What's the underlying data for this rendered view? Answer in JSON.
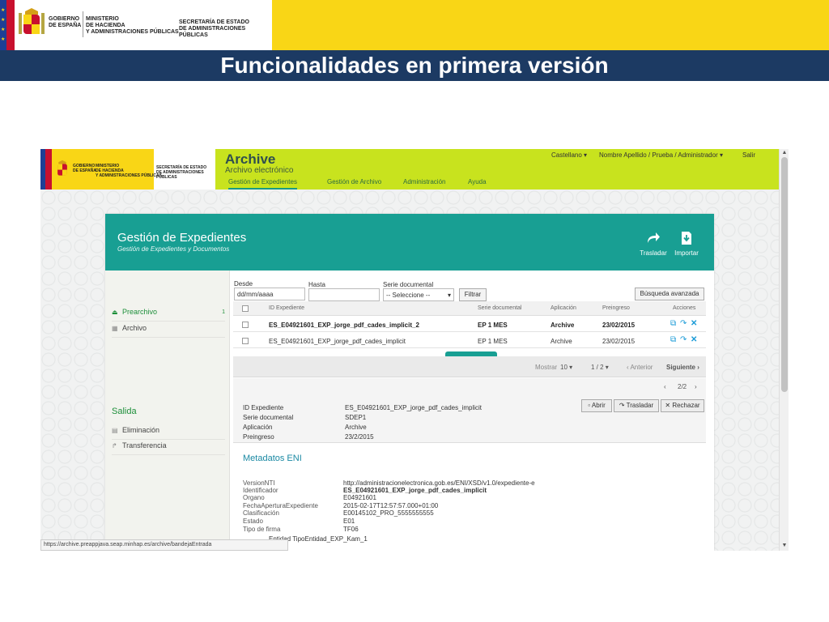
{
  "slide": {
    "gov_line1": "Gobierno",
    "gov_line2": "de España",
    "ministry_line1": "Ministerio",
    "ministry_line2": "de Hacienda",
    "ministry_line3": "y Administraciones Públicas",
    "secretariat_line1": "Secretaría de Estado",
    "secretariat_line2": "de Administraciones Públicas",
    "title": "Funcionalidades en primera versión"
  },
  "app": {
    "title": "Archive",
    "subtitle": "Archivo electrónico",
    "language": "Castellano ▾",
    "user": "Nombre Apellido / Prueba / Administrador ▾",
    "logout": "Salir",
    "nav": [
      "Gestión de Expedientes",
      "Gestión de Archivo",
      "Administración",
      "Ayuda"
    ]
  },
  "panel": {
    "title": "Gestión de Expedientes",
    "subtitle": "Gestión de Expedientes y Documentos",
    "actions": [
      {
        "label": "Trasladar",
        "icon": "share-arrow-icon"
      },
      {
        "label": "Importar",
        "icon": "import-icon"
      }
    ]
  },
  "sidebar": {
    "items": [
      {
        "label": "Prearchivo",
        "count": "1"
      },
      {
        "label": "Archivo"
      }
    ],
    "section": "Salida",
    "section_items": [
      "Eliminación",
      "Transferencia"
    ]
  },
  "filters": {
    "desde_label": "Desde",
    "desde_placeholder": "dd/mm/aaaa",
    "hasta_label": "Hasta",
    "serie_label": "Serie documental",
    "serie_value": "-- Seleccione --",
    "filter_button": "Filtrar",
    "advanced_button": "Búsqueda avanzada"
  },
  "table": {
    "headers": [
      "ID Expediente",
      "Serie documental",
      "Aplicación",
      "Preingreso",
      "Acciones"
    ],
    "rows": [
      {
        "id": "ES_E04921601_EXP_jorge_pdf_cades_implicit_2",
        "serie": "EP 1 MES",
        "app": "Archive",
        "date": "23/02/2015"
      },
      {
        "id": "ES_E04921601_EXP_jorge_pdf_cades_implicit",
        "serie": "EP 1 MES",
        "app": "Archive",
        "date": "23/02/2015"
      }
    ]
  },
  "pager": {
    "show": "Mostrar",
    "per_page": "10 ▾",
    "page": "1 / 2 ▾",
    "prev": "‹ Anterior",
    "next": "Siguiente ›"
  },
  "detail": {
    "nav": "2/2",
    "fields": [
      {
        "k": "ID Expediente",
        "v": "ES_E04921601_EXP_jorge_pdf_cades_implicit"
      },
      {
        "k": "Serie documental",
        "v": "SDEP1"
      },
      {
        "k": "Aplicación",
        "v": "Archive"
      },
      {
        "k": "Preingreso",
        "v": "23/2/2015"
      }
    ],
    "buttons": [
      "▫ Abrir",
      "↷ Trasladar",
      "✕ Rechazar"
    ]
  },
  "metadata": {
    "title": "Metadatos ENI",
    "fields": [
      {
        "k": "VersionNTI",
        "v": "http://administracionelectronica.gob.es/ENI/XSD/v1.0/expediente-e"
      },
      {
        "k": "Identificador",
        "v": "ES_E04921601_EXP_jorge_pdf_cades_implicit"
      },
      {
        "k": "Organo",
        "v": "E04921601"
      },
      {
        "k": "FechaAperturaExpediente",
        "v": "2015-02-17T12:57:57.000+01:00"
      },
      {
        "k": "Clasificación",
        "v": "E00145102_PRO_5555555555"
      },
      {
        "k": "Estado",
        "v": "E01"
      },
      {
        "k": "Tipo de firma",
        "v": "TF06"
      }
    ],
    "truncated": "Entidad TipoEntidad_EXP_Kam_1"
  },
  "status_url": "https://archive.preappjava.seap.minhap.es/archive/bandejaEntrada",
  "colors": {
    "slide_yellow": "#f9d616",
    "slide_navy": "#1c3a63",
    "app_lime": "#c8e31e",
    "panel_teal": "#189f93",
    "accent_green": "#1d8f3a"
  }
}
